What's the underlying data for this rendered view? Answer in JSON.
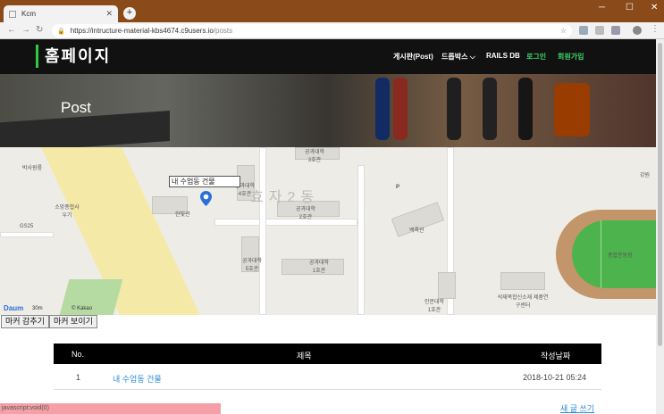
{
  "browser": {
    "tab_title": "Kcm",
    "url_host": "https://intructure-material-kbs4674.c9users.io",
    "url_path": "/posts",
    "new_tab_symbol": "+",
    "win_min": "─",
    "win_max": "☐",
    "win_close": "✕"
  },
  "site": {
    "brand": "홈페이지",
    "menu": {
      "posts": "게시판(Post)",
      "dropdown": "드롭박스",
      "rails_db": "RAILS DB",
      "login": "로그인",
      "signup": "회원가입"
    },
    "hero_title": "Post"
  },
  "map": {
    "info_label": "내 수업동 건물",
    "district": "효자2동",
    "provider": "Daum",
    "scale": "30m",
    "copyright": "© Kakao",
    "labels": {
      "l1": "박사원룸",
      "l2": "소망종합사우기",
      "l3": "GS25",
      "l4": "한빛관",
      "l5": "공과대학 4호관",
      "l6": "공과대학 3호관",
      "l7": "공과대학 2호관",
      "l8": "공과대학 5호관",
      "l9": "공과대학 1호관",
      "l10": "백록관",
      "l11": "석재복합신소재 제품연구센터",
      "l12": "인문대학 1호관",
      "l13": "종합운동장",
      "l14": "강원",
      "l15": "P"
    }
  },
  "buttons": {
    "hide_markers": "마커 감추기",
    "show_markers": "마커 보이기"
  },
  "table": {
    "headers": {
      "no": "No.",
      "title": "제목",
      "date": "작성날짜"
    },
    "rows": [
      {
        "no": "1",
        "title": "내 수업동 건물",
        "date": "2018-10-21 05:24"
      }
    ]
  },
  "write_link": "새 글 쓰기",
  "status_bar": "javascript:void(0)",
  "colors": {
    "nav_bg": "#111111",
    "brand_accent": "#2ecc40",
    "link": "#2a8ad8"
  }
}
